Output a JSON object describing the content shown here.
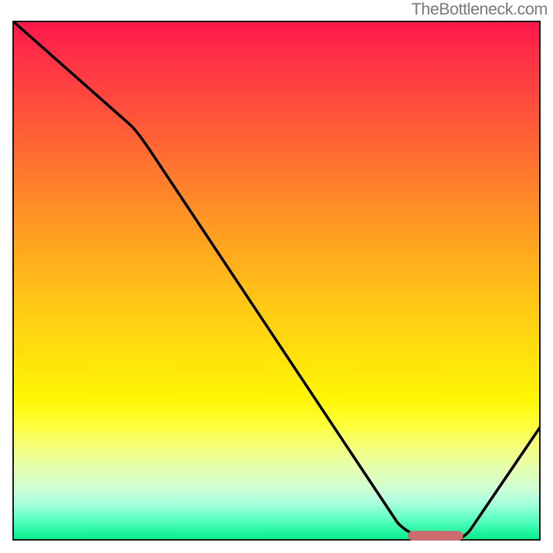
{
  "watermark": "TheBottleneck.com",
  "colors": {
    "gradient_top": "#ff1749",
    "gradient_bottom": "#00f08b",
    "curve": "#000000",
    "marker": "#cc6b6e",
    "border": "#000000"
  },
  "chart_data": {
    "type": "line",
    "title": "",
    "xlabel": "",
    "ylabel": "",
    "xlim": [
      0,
      100
    ],
    "ylim": [
      0,
      100
    ],
    "grid": false,
    "legend": false,
    "series": [
      {
        "name": "primary-curve",
        "x": [
          0,
          22,
          73,
          80,
          84,
          100
        ],
        "y": [
          100,
          80,
          3,
          0,
          0,
          22
        ]
      }
    ],
    "marker": {
      "x_start": 75,
      "x_end": 85,
      "y": 0,
      "shape": "pill"
    },
    "notes": "Background is a vertical red→yellow→green gradient; curve descends from top-left, reaches the bottom around x≈80, a pill marker sits at the minimum, then curve rises toward the right edge."
  }
}
